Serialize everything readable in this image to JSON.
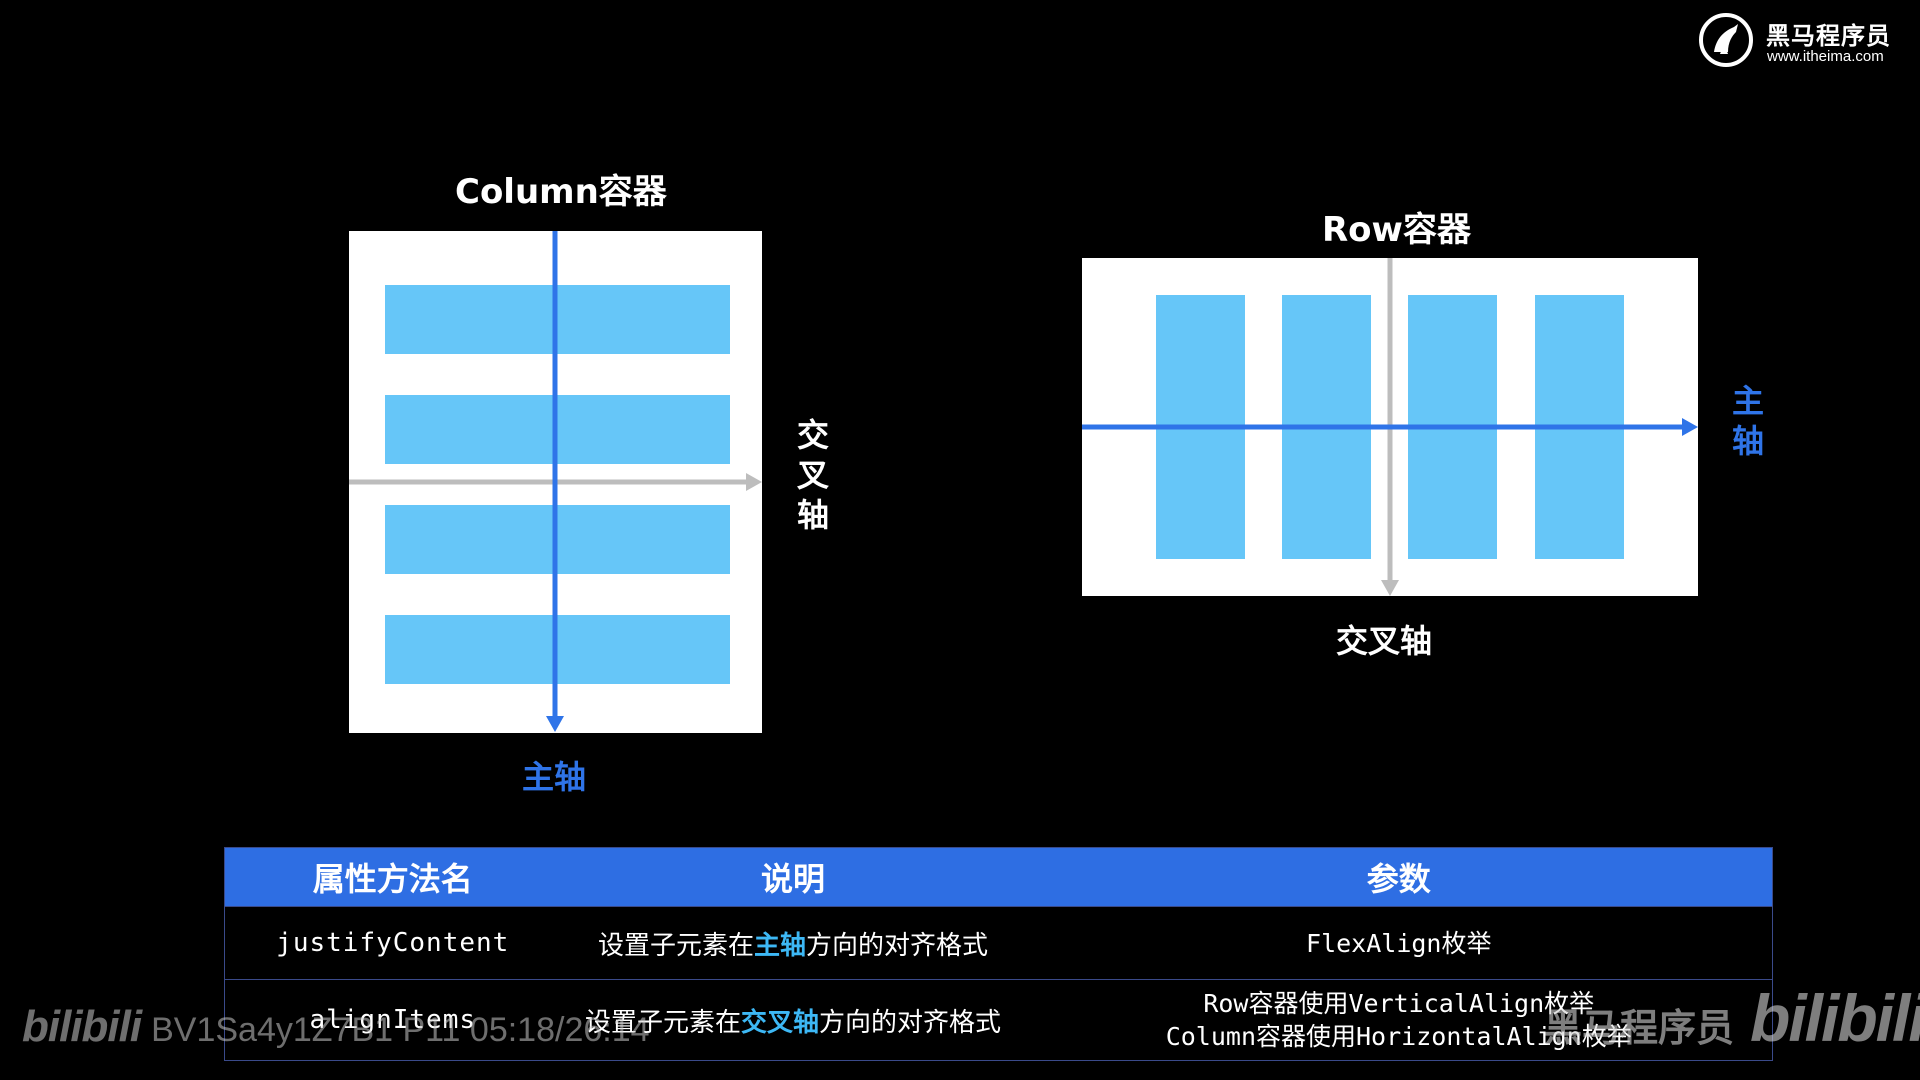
{
  "logo": {
    "name_cn": "黑马程序员",
    "url": "www.itheima.com"
  },
  "column_diagram": {
    "title": "Column容器",
    "main_axis_label": "主轴",
    "cross_axis_label": "交叉轴",
    "item_count": 4
  },
  "row_diagram": {
    "title": "Row容器",
    "main_axis_label": "主轴",
    "cross_axis_label": "交叉轴",
    "item_count": 4
  },
  "table": {
    "headers": [
      "属性方法名",
      "说明",
      "参数"
    ],
    "rows": [
      {
        "name": "justifyContent",
        "desc_pre": "设置子元素在",
        "desc_hl": "主轴",
        "desc_post": "方向的对齐格式",
        "param_lines": [
          "FlexAlign枚举"
        ]
      },
      {
        "name": "alignItems",
        "desc_pre": "设置子元素在",
        "desc_hl": "交叉轴",
        "desc_post": "方向的对齐格式",
        "param_lines": [
          "Row容器使用VerticalAlign枚举",
          "Column容器使用HorizontalAlign枚举"
        ]
      }
    ]
  },
  "watermarks": {
    "bilibili_logo": "bilibili",
    "video_info": "BV1Sa4y1Z7B1 P11 05:18/26:14",
    "right_cn": "黑马程序员",
    "right_logo": "bilibili"
  },
  "colors": {
    "main_axis": "#2f74e8",
    "cross_axis": "#bdbdbd",
    "item": "#66c6f8",
    "table_header": "#2e6ee3",
    "highlight": "#3db8f5"
  }
}
